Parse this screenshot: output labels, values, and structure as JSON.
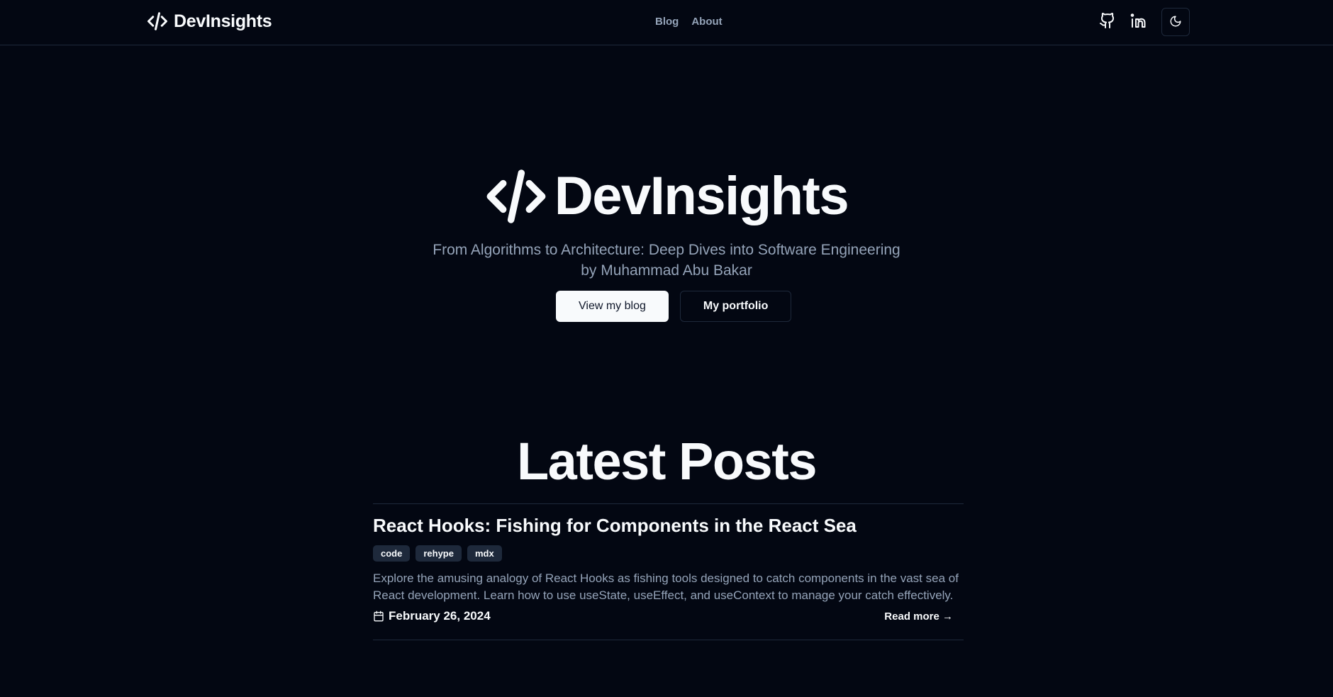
{
  "site": {
    "brand_name": "DevInsights",
    "brand_icon": "code-icon"
  },
  "nav": {
    "items": [
      {
        "label": "Blog"
      },
      {
        "label": "About"
      }
    ]
  },
  "header_actions": {
    "github_icon": "github-icon",
    "linkedin_icon": "linkedin-icon",
    "theme_icon": "moon-icon"
  },
  "hero": {
    "title": "DevInsights",
    "subtitle_line1": "From Algorithms to Architecture: Deep Dives into Software Engineering",
    "subtitle_line2": "by Muhammad Abu Bakar",
    "primary_button": "View my blog",
    "secondary_button": "My portfolio"
  },
  "latest": {
    "title": "Latest Posts",
    "posts": [
      {
        "title": "React Hooks: Fishing for Components in the React Sea",
        "tags": [
          "code",
          "rehype",
          "mdx"
        ],
        "description_line1": "Explore the amusing analogy of React Hooks as fishing tools designed to catch components in the vast sea of",
        "description_line2": "React development. Learn how to use useState, useEffect, and useContext to manage your catch effectively.",
        "date": "February 26, 2024",
        "read_more": "Read more →"
      }
    ]
  },
  "colors": {
    "background": "#030712",
    "foreground": "#f8fafc",
    "muted": "#94a3b8",
    "border": "#1e293b"
  }
}
